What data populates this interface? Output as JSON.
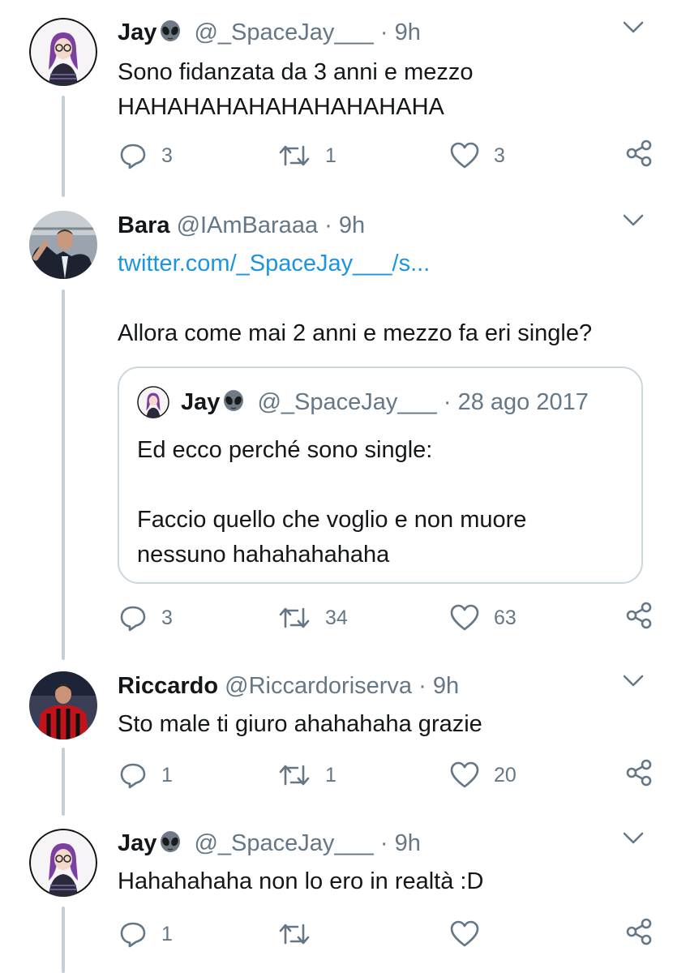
{
  "tweets": [
    {
      "name": "Jay",
      "name_icon": "alien-emoji-icon",
      "handle": "@_SpaceJay___",
      "dot": "·",
      "time": "9h",
      "text": "Sono fidanzata da 3 anni e mezzo\nHAHAHAHAHAHAHAHAHAHA",
      "replies": "3",
      "retweets": "1",
      "likes": "3"
    },
    {
      "name": "Bara",
      "handle": "@IAmBaraaa",
      "dot": "·",
      "time": "9h",
      "link": "twitter.com/_SpaceJay___/s...",
      "text": "Allora come mai 2 anni e mezzo fa eri single?",
      "quote": {
        "name": "Jay",
        "name_icon": "alien-emoji-icon",
        "handle": "@_SpaceJay___",
        "dot": "·",
        "time": "28 ago 2017",
        "text": "Ed ecco perché sono single:\n\nFaccio quello che voglio e non muore\nnessuno hahahahahaha"
      },
      "replies": "3",
      "retweets": "34",
      "likes": "63"
    },
    {
      "name": "Riccardo",
      "handle": "@Riccardoriserva",
      "dot": "·",
      "time": "9h",
      "text": "Sto male ti giuro ahahahaha grazie",
      "replies": "1",
      "retweets": "1",
      "likes": "20"
    },
    {
      "name": "Jay",
      "name_icon": "alien-emoji-icon",
      "handle": "@_SpaceJay___",
      "dot": "·",
      "time": "9h",
      "text": "Hahahahaha non lo ero in realtà :D",
      "replies": "1",
      "retweets": "",
      "likes": ""
    }
  ],
  "colors": {
    "text": "#14171a",
    "secondary": "#657786",
    "link": "#1b95e0",
    "thread_line": "#c4cfd6",
    "border": "#ccd6dd"
  }
}
